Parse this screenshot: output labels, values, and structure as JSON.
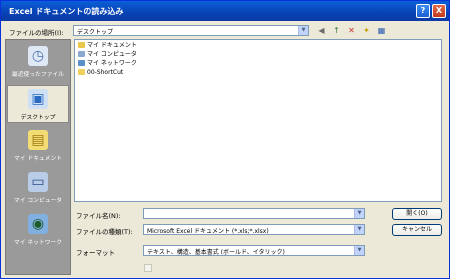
{
  "window": {
    "title": "Excel ドキュメントの読み込み"
  },
  "titlebar_buttons": {
    "help": "?",
    "close": "X"
  },
  "lookin": {
    "label": "ファイルの場所(I):",
    "value": "デスクトップ"
  },
  "places": [
    {
      "label": "最近使ったファイル",
      "icon": "recent-docs-icon"
    },
    {
      "label": "デスクトップ",
      "icon": "desktop-icon"
    },
    {
      "label": "マイ ドキュメント",
      "icon": "my-documents-icon"
    },
    {
      "label": "マイ コンピュータ",
      "icon": "my-computer-icon"
    },
    {
      "label": "マイ ネットワーク",
      "icon": "my-network-icon"
    }
  ],
  "files": [
    {
      "name": "マイ ドキュメント",
      "icon": "my-documents-icon"
    },
    {
      "name": "マイ コンピュータ",
      "icon": "my-computer-icon"
    },
    {
      "name": "マイ ネットワーク",
      "icon": "my-network-icon"
    },
    {
      "name": "00-ShortCut",
      "icon": "folder-icon"
    }
  ],
  "filename": {
    "label": "ファイル名(N):",
    "value": ""
  },
  "filetype": {
    "label": "ファイルの種類(T):",
    "value": "Microsoft Excel ドキュメント (*.xls;*.xlsx)"
  },
  "format": {
    "label": "フォーマット",
    "value": "テキスト、構造、基本書式 (ボールド、イタリック)"
  },
  "buttons": {
    "open": "開く(O)",
    "cancel": "キャンセル"
  },
  "colors": {
    "titlebar": "#0842b4",
    "dialog_bg": "#ece9d8",
    "places_bg": "#9a9a9a"
  }
}
